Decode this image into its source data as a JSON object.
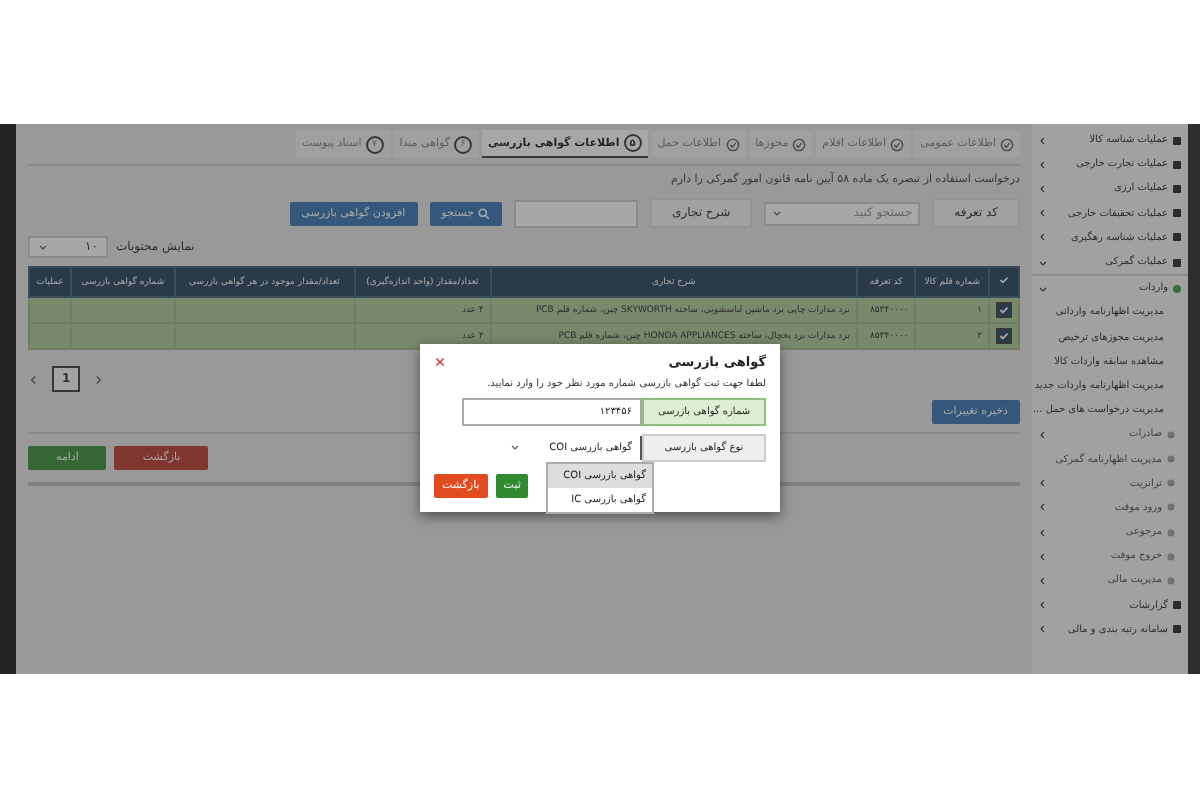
{
  "sidebar": {
    "items": [
      {
        "label": "عملیات شناسه کالا",
        "kind": "section",
        "expanded": false
      },
      {
        "label": "عملیات تجارت خارجی",
        "kind": "section",
        "expanded": false
      },
      {
        "label": "عملیات ارزی",
        "kind": "section",
        "expanded": false
      },
      {
        "label": "عملیات تحقیقات خارجی",
        "kind": "section",
        "expanded": false
      },
      {
        "label": "عملیات شناسه رهگیری",
        "kind": "section",
        "expanded": false
      },
      {
        "label": "عملیات گمرکی",
        "kind": "section",
        "expanded": true,
        "children": [
          {
            "label": "واردات",
            "kind": "active",
            "expanded": true,
            "children": [
              {
                "label": "مدیریت اظهارنامه وارداتی",
                "kind": "child"
              },
              {
                "label": "مدیریت مجوزهای ترخیص",
                "kind": "child"
              },
              {
                "label": "مشاهده سابقه واردات کالا",
                "kind": "child"
              },
              {
                "label": "مدیریت اظهارنامه واردات جدید",
                "kind": "child"
              },
              {
                "label": "مدیریت درخواست های حمل ...",
                "kind": "child"
              }
            ]
          },
          {
            "label": "صادرات",
            "kind": "module",
            "expanded": false
          },
          {
            "label": "مدیریت اظهارنامه گمرکی",
            "kind": "module"
          },
          {
            "label": "ترانزیت",
            "kind": "module",
            "expanded": false
          },
          {
            "label": "ورود موقت",
            "kind": "module",
            "expanded": false
          },
          {
            "label": "مرجوعی",
            "kind": "module",
            "expanded": false
          },
          {
            "label": "خروج موقت",
            "kind": "module",
            "expanded": false
          },
          {
            "label": "مدیریت مالی",
            "kind": "module",
            "expanded": false
          }
        ]
      },
      {
        "label": "گزارشات",
        "kind": "section",
        "expanded": false
      },
      {
        "label": "سامانه رتبه بندی و مالی",
        "kind": "section",
        "expanded": false
      }
    ]
  },
  "steps": [
    {
      "label": "اطلاعات عمومی",
      "done": true,
      "selected": false
    },
    {
      "label": "اطلاعات اقلام",
      "done": true,
      "selected": false
    },
    {
      "label": "مجوزها",
      "done": true,
      "selected": false
    },
    {
      "label": "اطلاعات حمل",
      "done": true,
      "selected": false
    },
    {
      "label": "اطلاعات گواهی بازرسی",
      "done": false,
      "number": "۵",
      "selected": true
    },
    {
      "label": "گواهی مبدا",
      "done": false,
      "number": "۶",
      "selected": false
    },
    {
      "label": "اسناد پیوست",
      "done": false,
      "number": "۷",
      "selected": false
    }
  ],
  "notice": "درخواست استفاده از تبصره یک ماده ۵۸ آیین نامه قانون امور گمرکی را دارم",
  "filters": {
    "tariff_label": "کد تعرفه",
    "tariff_placeholder": "جستجو کنید",
    "description_label": "شرح تجاری",
    "search_button": "جستجو",
    "add_button": "افزودن گواهی بازرسی"
  },
  "page_size": {
    "label": "نمایش محتویات",
    "value": "۱۰"
  },
  "table": {
    "columns": [
      "شماره قلم کالا",
      "کد تعرفه",
      "شرح تجاری",
      "تعداد/مقدار (واحد اندازه‌گیری)",
      "تعداد/مقدار موجود در هر گواهی بازرسی",
      "شماره گواهی بازرسی",
      "عملیات"
    ],
    "rows": [
      {
        "checked": true,
        "cells": [
          "۱",
          "۸۵۳۴۰۰۰۰",
          "برد مدارات چاپی برد ماشین لباسشویی، ساخته SKYWORTH چین، شماره قلم PCB",
          "۴ عدد",
          "",
          "",
          ""
        ]
      },
      {
        "checked": true,
        "cells": [
          "۲",
          "۸۵۳۴۰۰۰۰",
          "برد مدارات برد یخچال، ساخته HONDA APPLIANCES چین، شماره قلم PCB",
          "۴ عدد",
          "",
          "",
          ""
        ]
      }
    ]
  },
  "pagination": {
    "pages": [
      {
        "label": "1",
        "selected": true
      }
    ]
  },
  "save_button": "ذخیره تغییرات",
  "footer_buttons": [
    {
      "label": "بازگشت",
      "kind": "back"
    },
    {
      "label": "ادامه",
      "kind": "next"
    }
  ],
  "dialog": {
    "title": "گواهی بازرسی",
    "message": "لطفا جهت ثبت گواهی بازرسی شماره مورد نظر خود را وارد نمایید.",
    "number_label": "شماره گواهی بازرسی",
    "number_value": "۱۲۳۴۵۶",
    "type_label": "نوع گواهی بازرسی",
    "type_value": "گواهی بازرسی COI",
    "type_options": [
      {
        "label": "گواهی بازرسی COI",
        "selected": true
      },
      {
        "label": "گواهی بازرسی IC",
        "selected": false
      }
    ],
    "buttons": [
      {
        "label": "ثبت",
        "kind": "submit"
      },
      {
        "label": "بازگشت",
        "kind": "cancel"
      }
    ]
  }
}
